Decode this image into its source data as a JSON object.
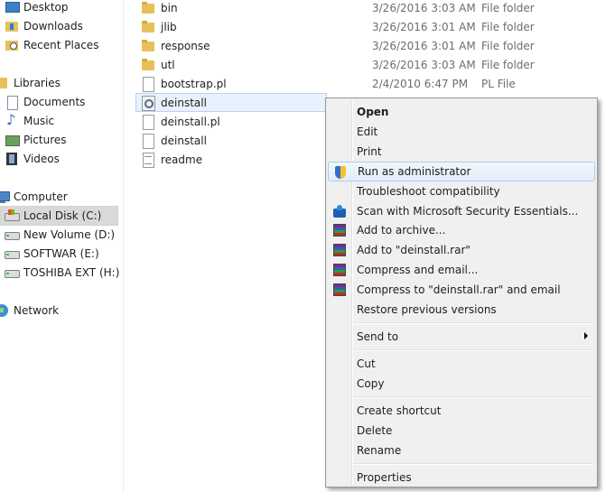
{
  "nav": {
    "items": [
      {
        "label": "Desktop",
        "icon": "desktop-icon"
      },
      {
        "label": "Downloads",
        "icon": "downloads-folder-icon"
      },
      {
        "label": "Recent Places",
        "icon": "recent-places-icon"
      },
      {
        "label": "Libraries",
        "icon": "libraries-icon"
      },
      {
        "label": "Documents",
        "icon": "documents-icon"
      },
      {
        "label": "Music",
        "icon": "music-icon"
      },
      {
        "label": "Pictures",
        "icon": "pictures-icon"
      },
      {
        "label": "Videos",
        "icon": "videos-icon"
      },
      {
        "label": "Computer",
        "icon": "computer-icon"
      },
      {
        "label": "Local Disk (C:)",
        "icon": "local-disk-icon",
        "selected": true
      },
      {
        "label": "New Volume (D:)",
        "icon": "drive-icon"
      },
      {
        "label": "SOFTWAR (E:)",
        "icon": "drive-icon"
      },
      {
        "label": "TOSHIBA EXT (H:)",
        "icon": "drive-icon"
      },
      {
        "label": "Network",
        "icon": "network-icon"
      }
    ]
  },
  "files": {
    "rows": [
      {
        "name": "bin",
        "date": "3/26/2016 3:03 AM",
        "type": "File folder",
        "icon": "folder-icon"
      },
      {
        "name": "jlib",
        "date": "3/26/2016 3:01 AM",
        "type": "File folder",
        "icon": "folder-icon"
      },
      {
        "name": "response",
        "date": "3/26/2016 3:01 AM",
        "type": "File folder",
        "icon": "folder-icon"
      },
      {
        "name": "utl",
        "date": "3/26/2016 3:03 AM",
        "type": "File folder",
        "icon": "folder-icon"
      },
      {
        "name": "bootstrap.pl",
        "date": "2/4/2010 6:47 PM",
        "type": "PL File",
        "icon": "file-icon"
      },
      {
        "name": "deinstall",
        "date": "",
        "type": "",
        "icon": "batch-file-icon",
        "selected": true
      },
      {
        "name": "deinstall.pl",
        "date": "",
        "type": "",
        "icon": "file-icon"
      },
      {
        "name": "deinstall",
        "date": "",
        "type": "",
        "icon": "file-icon"
      },
      {
        "name": "readme",
        "date": "",
        "type": "",
        "icon": "text-file-icon"
      }
    ]
  },
  "context_menu": {
    "items": [
      {
        "label": "Open",
        "bold": true
      },
      {
        "label": "Edit"
      },
      {
        "label": "Print"
      },
      {
        "label": "Run as administrator",
        "icon": "uac-shield-icon",
        "hover": true
      },
      {
        "label": "Troubleshoot compatibility"
      },
      {
        "label": "Scan with Microsoft Security Essentials...",
        "icon": "security-essentials-icon"
      },
      {
        "label": "Add to archive...",
        "icon": "winrar-icon"
      },
      {
        "label": "Add to \"deinstall.rar\"",
        "icon": "winrar-icon"
      },
      {
        "label": "Compress and email...",
        "icon": "winrar-icon"
      },
      {
        "label": "Compress to \"deinstall.rar\" and email",
        "icon": "winrar-icon"
      },
      {
        "label": "Restore previous versions"
      },
      {
        "label": "Send to",
        "submenu": true
      },
      {
        "label": "Cut"
      },
      {
        "label": "Copy"
      },
      {
        "label": "Create shortcut"
      },
      {
        "label": "Delete"
      },
      {
        "label": "Rename"
      },
      {
        "label": "Properties"
      }
    ]
  },
  "colors": {
    "selection_background": "#e9f2fc",
    "menu_background": "#f0f0f0",
    "hover_border": "#aecbea"
  }
}
